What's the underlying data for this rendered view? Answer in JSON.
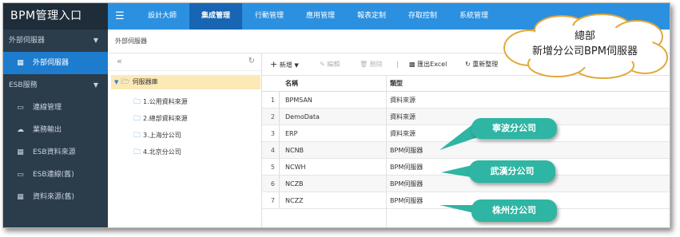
{
  "app": {
    "title": "BPM管理入口"
  },
  "sidebar": {
    "sections": [
      {
        "label": "外部伺服器",
        "items": [
          {
            "label": "外部伺服器",
            "icon": "database-icon",
            "active": true
          }
        ]
      },
      {
        "label": "ESB服務",
        "items": [
          {
            "label": "連線管理",
            "icon": "monitor-icon"
          },
          {
            "label": "業務輸出",
            "icon": "cloud-icon"
          },
          {
            "label": "ESB資料來源",
            "icon": "database-icon"
          },
          {
            "label": "ESB連線(舊)",
            "icon": "monitor-icon"
          },
          {
            "label": "資料來源(舊)",
            "icon": "database-icon"
          }
        ]
      }
    ]
  },
  "topnav": {
    "items": [
      {
        "label": "設計大師"
      },
      {
        "label": "集成管理",
        "active": true
      },
      {
        "label": "行動管理"
      },
      {
        "label": "應用管理"
      },
      {
        "label": "報表定制"
      },
      {
        "label": "存取控制"
      },
      {
        "label": "系統管理"
      }
    ]
  },
  "breadcrumb": "外部伺服器",
  "tree": {
    "root": "伺服器庫",
    "children": [
      "1.公用資料來源",
      "2.總部資料來源",
      "3.上海分公司",
      "4.北京分公司"
    ]
  },
  "toolbar": {
    "add": "新增",
    "edit": "編輯",
    "delete": "刪除",
    "export": "匯出Excel",
    "refresh": "重新整理"
  },
  "table": {
    "columns": [
      "名稱",
      "類型"
    ],
    "rows": [
      {
        "n": "1",
        "name": "BPMSAN",
        "type": "資料來源"
      },
      {
        "n": "2",
        "name": "DemoData",
        "type": "資料來源"
      },
      {
        "n": "3",
        "name": "ERP",
        "type": "資料來源"
      },
      {
        "n": "4",
        "name": "NCNB",
        "type": "BPM伺服器"
      },
      {
        "n": "5",
        "name": "NCWH",
        "type": "BPM伺服器"
      },
      {
        "n": "6",
        "name": "NCZB",
        "type": "BPM伺服器"
      },
      {
        "n": "7",
        "name": "NCZZ",
        "type": "BPM伺服器"
      }
    ]
  },
  "callouts": {
    "ningbo": "寧波分公司",
    "wuhan": "武漢分公司",
    "zhuzhou": "株州分公司",
    "cloud_line1": "總部",
    "cloud_line2": "新增分公司BPM伺服器",
    "color": "#2eb5a3"
  },
  "colors": {
    "sidebar": "#2b3c4b",
    "topnav": "#2b90e0",
    "accent": "#1e7ccf",
    "selected_tree": "#fce9b5"
  }
}
